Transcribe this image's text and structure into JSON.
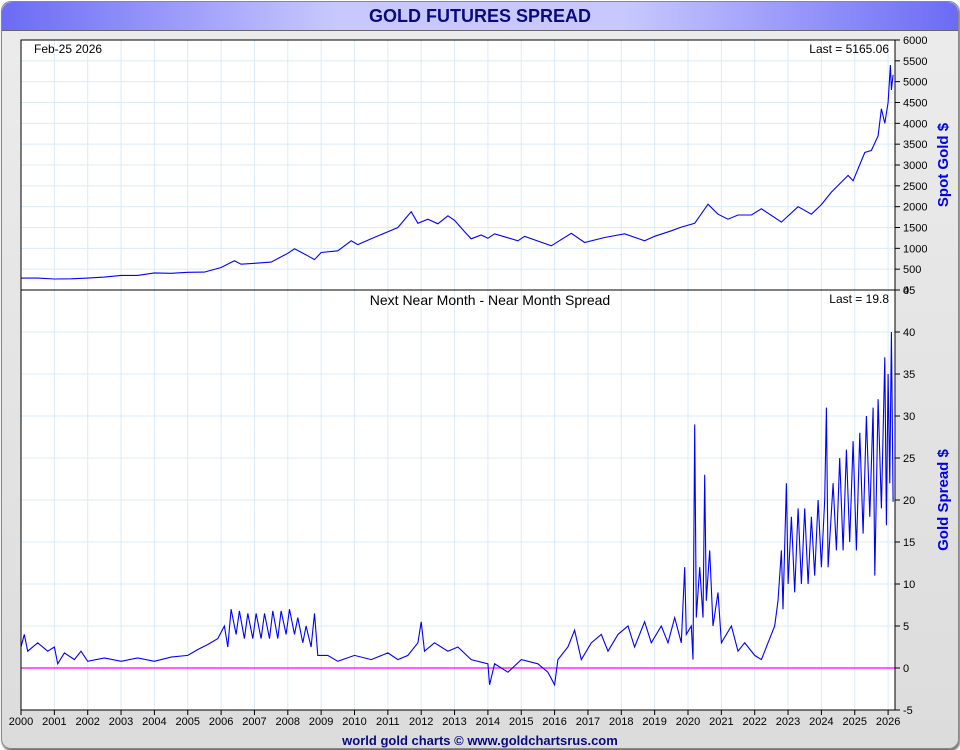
{
  "title": "GOLD FUTURES SPREAD",
  "footer": "world gold charts © www.goldchartsrus.com",
  "colors": {
    "line": "#0000ff",
    "zero": "#ff00ff",
    "grid": "#dcebf7"
  },
  "chart_data": [
    {
      "type": "line",
      "title": "",
      "date_label": "Feb-25  2026",
      "last_label": "Last = 5165.06",
      "ylabel": "Spot Gold $",
      "ylim": [
        0,
        6000
      ],
      "yticks": [
        0,
        500,
        1000,
        1500,
        2000,
        2500,
        3000,
        3500,
        4000,
        4500,
        5000,
        5500,
        6000
      ],
      "points": [
        [
          2000,
          285
        ],
        [
          2000.5,
          285
        ],
        [
          2001,
          265
        ],
        [
          2001.5,
          270
        ],
        [
          2002,
          285
        ],
        [
          2002.5,
          310
        ],
        [
          2003,
          350
        ],
        [
          2003.5,
          350
        ],
        [
          2004,
          410
        ],
        [
          2004.5,
          400
        ],
        [
          2005,
          425
        ],
        [
          2005.5,
          430
        ],
        [
          2006,
          540
        ],
        [
          2006.4,
          700
        ],
        [
          2006.6,
          620
        ],
        [
          2007,
          640
        ],
        [
          2007.5,
          670
        ],
        [
          2008,
          880
        ],
        [
          2008.2,
          990
        ],
        [
          2008.6,
          820
        ],
        [
          2008.8,
          730
        ],
        [
          2009,
          900
        ],
        [
          2009.5,
          940
        ],
        [
          2009.9,
          1180
        ],
        [
          2010.1,
          1090
        ],
        [
          2010.5,
          1230
        ],
        [
          2011,
          1400
        ],
        [
          2011.3,
          1500
        ],
        [
          2011.7,
          1880
        ],
        [
          2011.9,
          1600
        ],
        [
          2012.2,
          1700
        ],
        [
          2012.5,
          1590
        ],
        [
          2012.8,
          1780
        ],
        [
          2013,
          1670
        ],
        [
          2013.3,
          1400
        ],
        [
          2013.5,
          1230
        ],
        [
          2013.8,
          1320
        ],
        [
          2014,
          1240
        ],
        [
          2014.2,
          1350
        ],
        [
          2014.9,
          1180
        ],
        [
          2015.1,
          1290
        ],
        [
          2015.9,
          1060
        ],
        [
          2016.5,
          1360
        ],
        [
          2016.9,
          1140
        ],
        [
          2017.5,
          1260
        ],
        [
          2018.1,
          1350
        ],
        [
          2018.7,
          1180
        ],
        [
          2019,
          1290
        ],
        [
          2019.5,
          1420
        ],
        [
          2019.8,
          1510
        ],
        [
          2020.2,
          1600
        ],
        [
          2020.6,
          2060
        ],
        [
          2020.9,
          1820
        ],
        [
          2021.2,
          1700
        ],
        [
          2021.5,
          1800
        ],
        [
          2021.9,
          1800
        ],
        [
          2022.2,
          1950
        ],
        [
          2022.8,
          1630
        ],
        [
          2023.3,
          2000
        ],
        [
          2023.7,
          1820
        ],
        [
          2024,
          2050
        ],
        [
          2024.3,
          2350
        ],
        [
          2024.8,
          2750
        ],
        [
          2024.95,
          2620
        ],
        [
          2025.3,
          3300
        ],
        [
          2025.5,
          3350
        ],
        [
          2025.7,
          3700
        ],
        [
          2025.8,
          4350
        ],
        [
          2025.9,
          4000
        ],
        [
          2026.0,
          4500
        ],
        [
          2026.07,
          5400
        ],
        [
          2026.1,
          4800
        ],
        [
          2026.15,
          5165
        ]
      ]
    },
    {
      "type": "line",
      "title": "Next Near Month - Near Month Spread",
      "last_label": "Last = 19.8",
      "ylabel": "Gold Spread $",
      "ylim": [
        -5,
        45
      ],
      "yticks": [
        -5,
        0,
        5,
        10,
        15,
        20,
        25,
        30,
        35,
        40,
        45
      ],
      "xticks": [
        "2000",
        "2001",
        "2002",
        "2003",
        "2004",
        "2005",
        "2006",
        "2007",
        "2008",
        "2009",
        "2010",
        "2011",
        "2012",
        "2013",
        "2014",
        "2015",
        "2016",
        "2017",
        "2018",
        "2019",
        "2020",
        "2021",
        "2022",
        "2023",
        "2024",
        "2025",
        "2026"
      ],
      "points": [
        [
          2000,
          2.5
        ],
        [
          2000.1,
          4
        ],
        [
          2000.2,
          2
        ],
        [
          2000.5,
          3
        ],
        [
          2000.8,
          2
        ],
        [
          2001,
          2.5
        ],
        [
          2001.1,
          0.5
        ],
        [
          2001.3,
          1.8
        ],
        [
          2001.6,
          1
        ],
        [
          2001.8,
          2
        ],
        [
          2002,
          0.8
        ],
        [
          2002.5,
          1.2
        ],
        [
          2003,
          0.8
        ],
        [
          2003.5,
          1.2
        ],
        [
          2004,
          0.8
        ],
        [
          2004.5,
          1.3
        ],
        [
          2005,
          1.5
        ],
        [
          2005.3,
          2.2
        ],
        [
          2005.6,
          2.8
        ],
        [
          2005.9,
          3.5
        ],
        [
          2006.1,
          5
        ],
        [
          2006.2,
          2.5
        ],
        [
          2006.3,
          7
        ],
        [
          2006.45,
          4
        ],
        [
          2006.55,
          6.8
        ],
        [
          2006.7,
          3.5
        ],
        [
          2006.8,
          6.5
        ],
        [
          2006.95,
          3.5
        ],
        [
          2007.05,
          6.5
        ],
        [
          2007.2,
          3.5
        ],
        [
          2007.3,
          6.5
        ],
        [
          2007.45,
          3.5
        ],
        [
          2007.55,
          6.8
        ],
        [
          2007.7,
          3.5
        ],
        [
          2007.8,
          6.8
        ],
        [
          2007.95,
          4
        ],
        [
          2008.05,
          7
        ],
        [
          2008.2,
          4
        ],
        [
          2008.3,
          6
        ],
        [
          2008.45,
          3
        ],
        [
          2008.55,
          5
        ],
        [
          2008.7,
          2.5
        ],
        [
          2008.8,
          6.5
        ],
        [
          2008.9,
          1.5
        ],
        [
          2009.2,
          1.5
        ],
        [
          2009.5,
          0.8
        ],
        [
          2010,
          1.5
        ],
        [
          2010.5,
          1
        ],
        [
          2011,
          1.8
        ],
        [
          2011.3,
          1
        ],
        [
          2011.6,
          1.5
        ],
        [
          2011.9,
          3
        ],
        [
          2012.0,
          5.5
        ],
        [
          2012.1,
          2
        ],
        [
          2012.4,
          3
        ],
        [
          2012.8,
          2
        ],
        [
          2013.1,
          2.5
        ],
        [
          2013.5,
          1
        ],
        [
          2014,
          0.5
        ],
        [
          2014.05,
          -2
        ],
        [
          2014.2,
          0.5
        ],
        [
          2014.6,
          -0.5
        ],
        [
          2015,
          1
        ],
        [
          2015.5,
          0.5
        ],
        [
          2015.8,
          -0.5
        ],
        [
          2016.0,
          -2
        ],
        [
          2016.1,
          1
        ],
        [
          2016.4,
          2.5
        ],
        [
          2016.6,
          4.5
        ],
        [
          2016.8,
          1
        ],
        [
          2017.1,
          3
        ],
        [
          2017.4,
          4
        ],
        [
          2017.6,
          2
        ],
        [
          2017.9,
          4
        ],
        [
          2018.2,
          5
        ],
        [
          2018.4,
          2.5
        ],
        [
          2018.7,
          5.5
        ],
        [
          2018.9,
          3
        ],
        [
          2019.2,
          5
        ],
        [
          2019.4,
          3
        ],
        [
          2019.6,
          6
        ],
        [
          2019.8,
          3
        ],
        [
          2019.9,
          12
        ],
        [
          2019.95,
          4
        ],
        [
          2020.1,
          5
        ],
        [
          2020.15,
          1
        ],
        [
          2020.2,
          29
        ],
        [
          2020.25,
          6
        ],
        [
          2020.35,
          12
        ],
        [
          2020.45,
          6
        ],
        [
          2020.5,
          23
        ],
        [
          2020.55,
          8
        ],
        [
          2020.65,
          14
        ],
        [
          2020.75,
          5
        ],
        [
          2020.9,
          9
        ],
        [
          2021.0,
          3
        ],
        [
          2021.3,
          5
        ],
        [
          2021.5,
          2
        ],
        [
          2021.7,
          3
        ],
        [
          2022,
          1.5
        ],
        [
          2022.2,
          1
        ],
        [
          2022.4,
          3
        ],
        [
          2022.6,
          5
        ],
        [
          2022.7,
          8
        ],
        [
          2022.8,
          14
        ],
        [
          2022.85,
          7
        ],
        [
          2022.95,
          22
        ],
        [
          2023.0,
          10
        ],
        [
          2023.1,
          18
        ],
        [
          2023.2,
          9
        ],
        [
          2023.3,
          19
        ],
        [
          2023.4,
          10
        ],
        [
          2023.5,
          19
        ],
        [
          2023.6,
          10
        ],
        [
          2023.7,
          18
        ],
        [
          2023.8,
          11
        ],
        [
          2023.9,
          20
        ],
        [
          2024.0,
          12
        ],
        [
          2024.1,
          20
        ],
        [
          2024.15,
          31
        ],
        [
          2024.2,
          12
        ],
        [
          2024.35,
          22
        ],
        [
          2024.45,
          14
        ],
        [
          2024.55,
          25
        ],
        [
          2024.65,
          14
        ],
        [
          2024.75,
          26
        ],
        [
          2024.85,
          15
        ],
        [
          2024.95,
          27
        ],
        [
          2025.05,
          14
        ],
        [
          2025.15,
          28
        ],
        [
          2025.25,
          16
        ],
        [
          2025.35,
          30
        ],
        [
          2025.45,
          18
        ],
        [
          2025.55,
          31
        ],
        [
          2025.6,
          11
        ],
        [
          2025.7,
          32
        ],
        [
          2025.8,
          19
        ],
        [
          2025.9,
          37
        ],
        [
          2025.95,
          17
        ],
        [
          2026.0,
          35
        ],
        [
          2026.05,
          22
        ],
        [
          2026.1,
          40
        ],
        [
          2026.15,
          19.8
        ]
      ]
    }
  ]
}
